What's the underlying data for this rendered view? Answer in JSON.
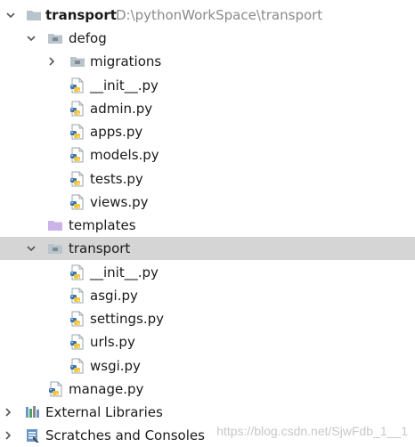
{
  "tree": {
    "root": {
      "label": "transport",
      "path": "D:\\pythonWorkSpace\\transport"
    },
    "defog": {
      "label": "defog",
      "migrations": "migrations",
      "files": [
        "__init__.py",
        "admin.py",
        "apps.py",
        "models.py",
        "tests.py",
        "views.py"
      ]
    },
    "templates": "templates",
    "transport": {
      "label": "transport",
      "files": [
        "__init__.py",
        "asgi.py",
        "settings.py",
        "urls.py",
        "wsgi.py"
      ]
    },
    "manage": "manage.py",
    "external_libraries": "External Libraries",
    "scratches": "Scratches and Consoles"
  },
  "watermark": "https://blog.csdn.net/SjwFdb_1__1",
  "colors": {
    "selection": "#d5d5d5",
    "folder": "#b8c4cc",
    "templates_folder": "#c9b3e8",
    "python_blue": "#3b75ad",
    "python_yellow": "#f2c53d"
  }
}
